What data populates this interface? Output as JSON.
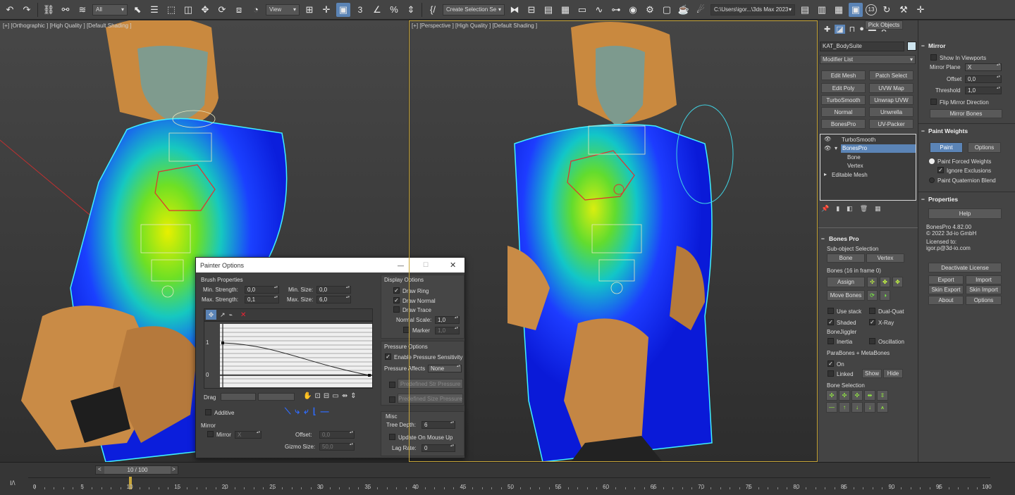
{
  "toolbar": {
    "filter_select": "All",
    "view_select": "View",
    "create_selection_set": "Create Selection Se",
    "path": "C:\\Users\\igor...\\3ds Max 2023",
    "badge_count": "13"
  },
  "viewport_left": {
    "label": "[+] [Orthographic ] [High Quality ] [Default Shading ]"
  },
  "viewport_right": {
    "label": "[+] [Perspective ] [High Quality ] [Default Shading ]"
  },
  "cmd": {
    "object_name": "KAT_BodySuite",
    "modifier_list": "Modifier List",
    "buttons": [
      "Edit Mesh",
      "Patch Select",
      "Edit Poly",
      "UVW Map",
      "TurboSmooth",
      "Unwrap UVW",
      "Normal",
      "Unwrella",
      "BonesPro",
      "UV-Packer"
    ],
    "stack": {
      "turbosmooth": "TurboSmooth",
      "bonespro": "BonesPro",
      "bone": "Bone",
      "vertex": "Vertex",
      "editable_mesh": "Editable Mesh"
    },
    "bonespro_panel": {
      "title": "Bones Pro",
      "subobject": "Sub-object Selection",
      "bone_btn": "Bone",
      "vertex_btn": "Vertex",
      "bones_count": "Bones (16 in frame 0)",
      "assign": "Assign",
      "move_bones": "Move Bones",
      "use_stack": "Use stack",
      "dual_quat": "Dual-Quat",
      "shaded": "Shaded",
      "xray": "X-Ray",
      "bonejiggler": "BoneJiggler",
      "inertia": "Inertia",
      "oscillation": "Oscillation",
      "parabones": "ParaBones + MetaBones",
      "on": "On",
      "pick_objects": "Pick Objects",
      "linked": "Linked",
      "show": "Show",
      "hide": "Hide",
      "bone_selection": "Bone Selection"
    }
  },
  "right": {
    "mirror": {
      "title": "Mirror",
      "show_in_viewports": "Show In Viewports",
      "mirror_plane_label": "Mirror Plane",
      "mirror_plane_value": "X",
      "offset_label": "Offset",
      "offset_value": "0,0",
      "threshold_label": "Threshold",
      "threshold_value": "1,0",
      "flip_mirror": "Flip Mirror Direction",
      "mirror_bones": "Mirror Bones"
    },
    "paint_weights": {
      "title": "Paint Weights",
      "paint": "Paint",
      "options": "Options",
      "paint_forced": "Paint Forced Weights",
      "ignore_exclusions": "Ignore Exclusions",
      "paint_quaternion": "Paint Quaternion Blend"
    },
    "properties": {
      "title": "Properties",
      "help": "Help",
      "version": "BonesPro 4.82.00",
      "copyright": "© 2022 3d-io GmbH",
      "licensed_to": "Licensed to:",
      "email": "igor.p@3d-io.com",
      "deactivate": "Deactivate License",
      "export": "Export",
      "import": "Import",
      "skin_export": "Skin Export",
      "skin_import": "Skin Import",
      "about": "About",
      "options": "Options"
    }
  },
  "painter": {
    "title": "Painter Options",
    "brush_properties": "Brush Properties",
    "min_strength_label": "Min. Strength:",
    "min_strength": "0,0",
    "max_strength_label": "Max. Strength:",
    "max_strength": "0,1",
    "min_size_label": "Min. Size:",
    "min_size": "0,0",
    "max_size_label": "Max. Size:",
    "max_size": "6,0",
    "curve_y1": "1",
    "curve_y0": "0",
    "drag_label": "Drag",
    "additive": "Additive",
    "mirror_group": "Mirror",
    "mirror": "Mirror",
    "mirror_axis": "X",
    "offset_label": "Offset:",
    "offset": "0,0",
    "gizmo_label": "Gizmo Size:",
    "gizmo": "50,0",
    "display_options": "Display Options",
    "draw_ring": "Draw Ring",
    "draw_normal": "Draw Normal",
    "draw_trace": "Draw Trace",
    "normal_scale_label": "Normal Scale:",
    "normal_scale": "1,0",
    "marker": "Marker",
    "marker_value": "1,0",
    "pressure_options": "Pressure Options",
    "enable_pressure": "Enable Pressure Sensitivity",
    "pressure_affects": "Pressure Affects",
    "pressure_affects_value": "None",
    "predef_str": "Predefined Str Pressure",
    "predef_size": "Predefined Size Pressure",
    "misc": "Misc",
    "tree_depth_label": "Tree Depth:",
    "tree_depth": "6",
    "update_on_mouse_up": "Update On Mouse Up",
    "lag_rate_label": "Lag Rate:",
    "lag_rate": "0"
  },
  "timeline": {
    "frame_display": "10 / 100",
    "ticks": [
      "0",
      "5",
      "10",
      "15",
      "20",
      "25",
      "30",
      "35",
      "40",
      "45",
      "50",
      "55",
      "60",
      "65",
      "70",
      "75",
      "80",
      "85",
      "90",
      "95",
      "100"
    ]
  }
}
